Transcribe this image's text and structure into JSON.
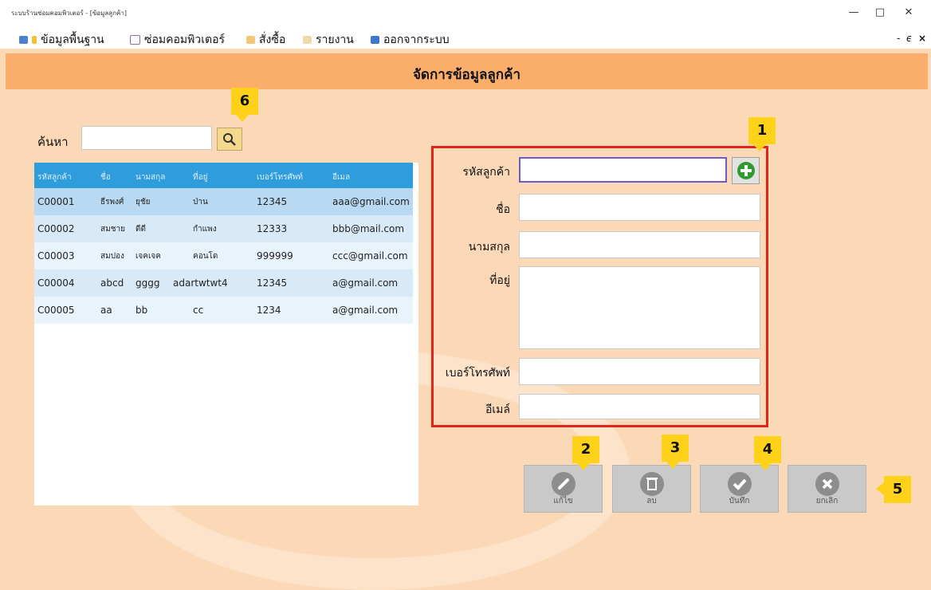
{
  "window": {
    "title": "ระบบร้านซ่อมคอมพิวเตอร์ - [ข้อมูลลูกค้า]"
  },
  "menu": [
    "ข้อมูลพื้นฐาน",
    "ซ่อมคอมพิวเตอร์",
    "สั่งซื้อ",
    "รายงาน",
    "ออกจากระบบ"
  ],
  "header": {
    "title": "จัดการข้อมูลลูกค้า"
  },
  "search": {
    "label": "ค้นหา",
    "value": ""
  },
  "table": {
    "columns": [
      "รหัสลูกค้า",
      "ชื่อ",
      "นามสกุล",
      "ที่อยู่",
      "เบอร์โทรศัพท์",
      "อีเมล"
    ],
    "rows": [
      [
        "C00001",
        "ธีรพงศ์",
        "ยุชัย",
        "ป่าน",
        "12345",
        "aaa@gmail.com"
      ],
      [
        "C00002",
        "สมชาย",
        "ดีดี",
        "กำแพง",
        "12333",
        "bbb@mail.com"
      ],
      [
        "C00003",
        "สมปอง",
        "เจคเจค",
        "คอนโด",
        "999999",
        "ccc@gmail.com"
      ],
      [
        "C00004",
        "abcd",
        "gggg",
        "adartwtwt4",
        "12345",
        "a@gmail.com"
      ],
      [
        "C00005",
        "aa",
        "bb",
        "cc",
        "1234",
        "a@gmail.com"
      ]
    ]
  },
  "form": {
    "customer_id_label": "รหัสลูกค้า",
    "first_name_label": "ชื่อ",
    "last_name_label": "นามสกุล",
    "address_label": "ที่อยู่",
    "phone_label": "เบอร์โทรศัพท์",
    "email_label": "อีเมล์"
  },
  "actions": {
    "edit": "แก้ไข",
    "delete": "ลบ",
    "save": "บันทึก",
    "cancel": "ยกเลิก"
  },
  "badges": [
    "1",
    "2",
    "3",
    "4",
    "5",
    "6"
  ],
  "colors": {
    "header": "#fbae6c",
    "background": "#fbd8b6",
    "table_header": "#2f9cdb",
    "highlight_box": "#e4231c",
    "badge": "#ffd21a",
    "add_icon": "#2e9b2e"
  }
}
